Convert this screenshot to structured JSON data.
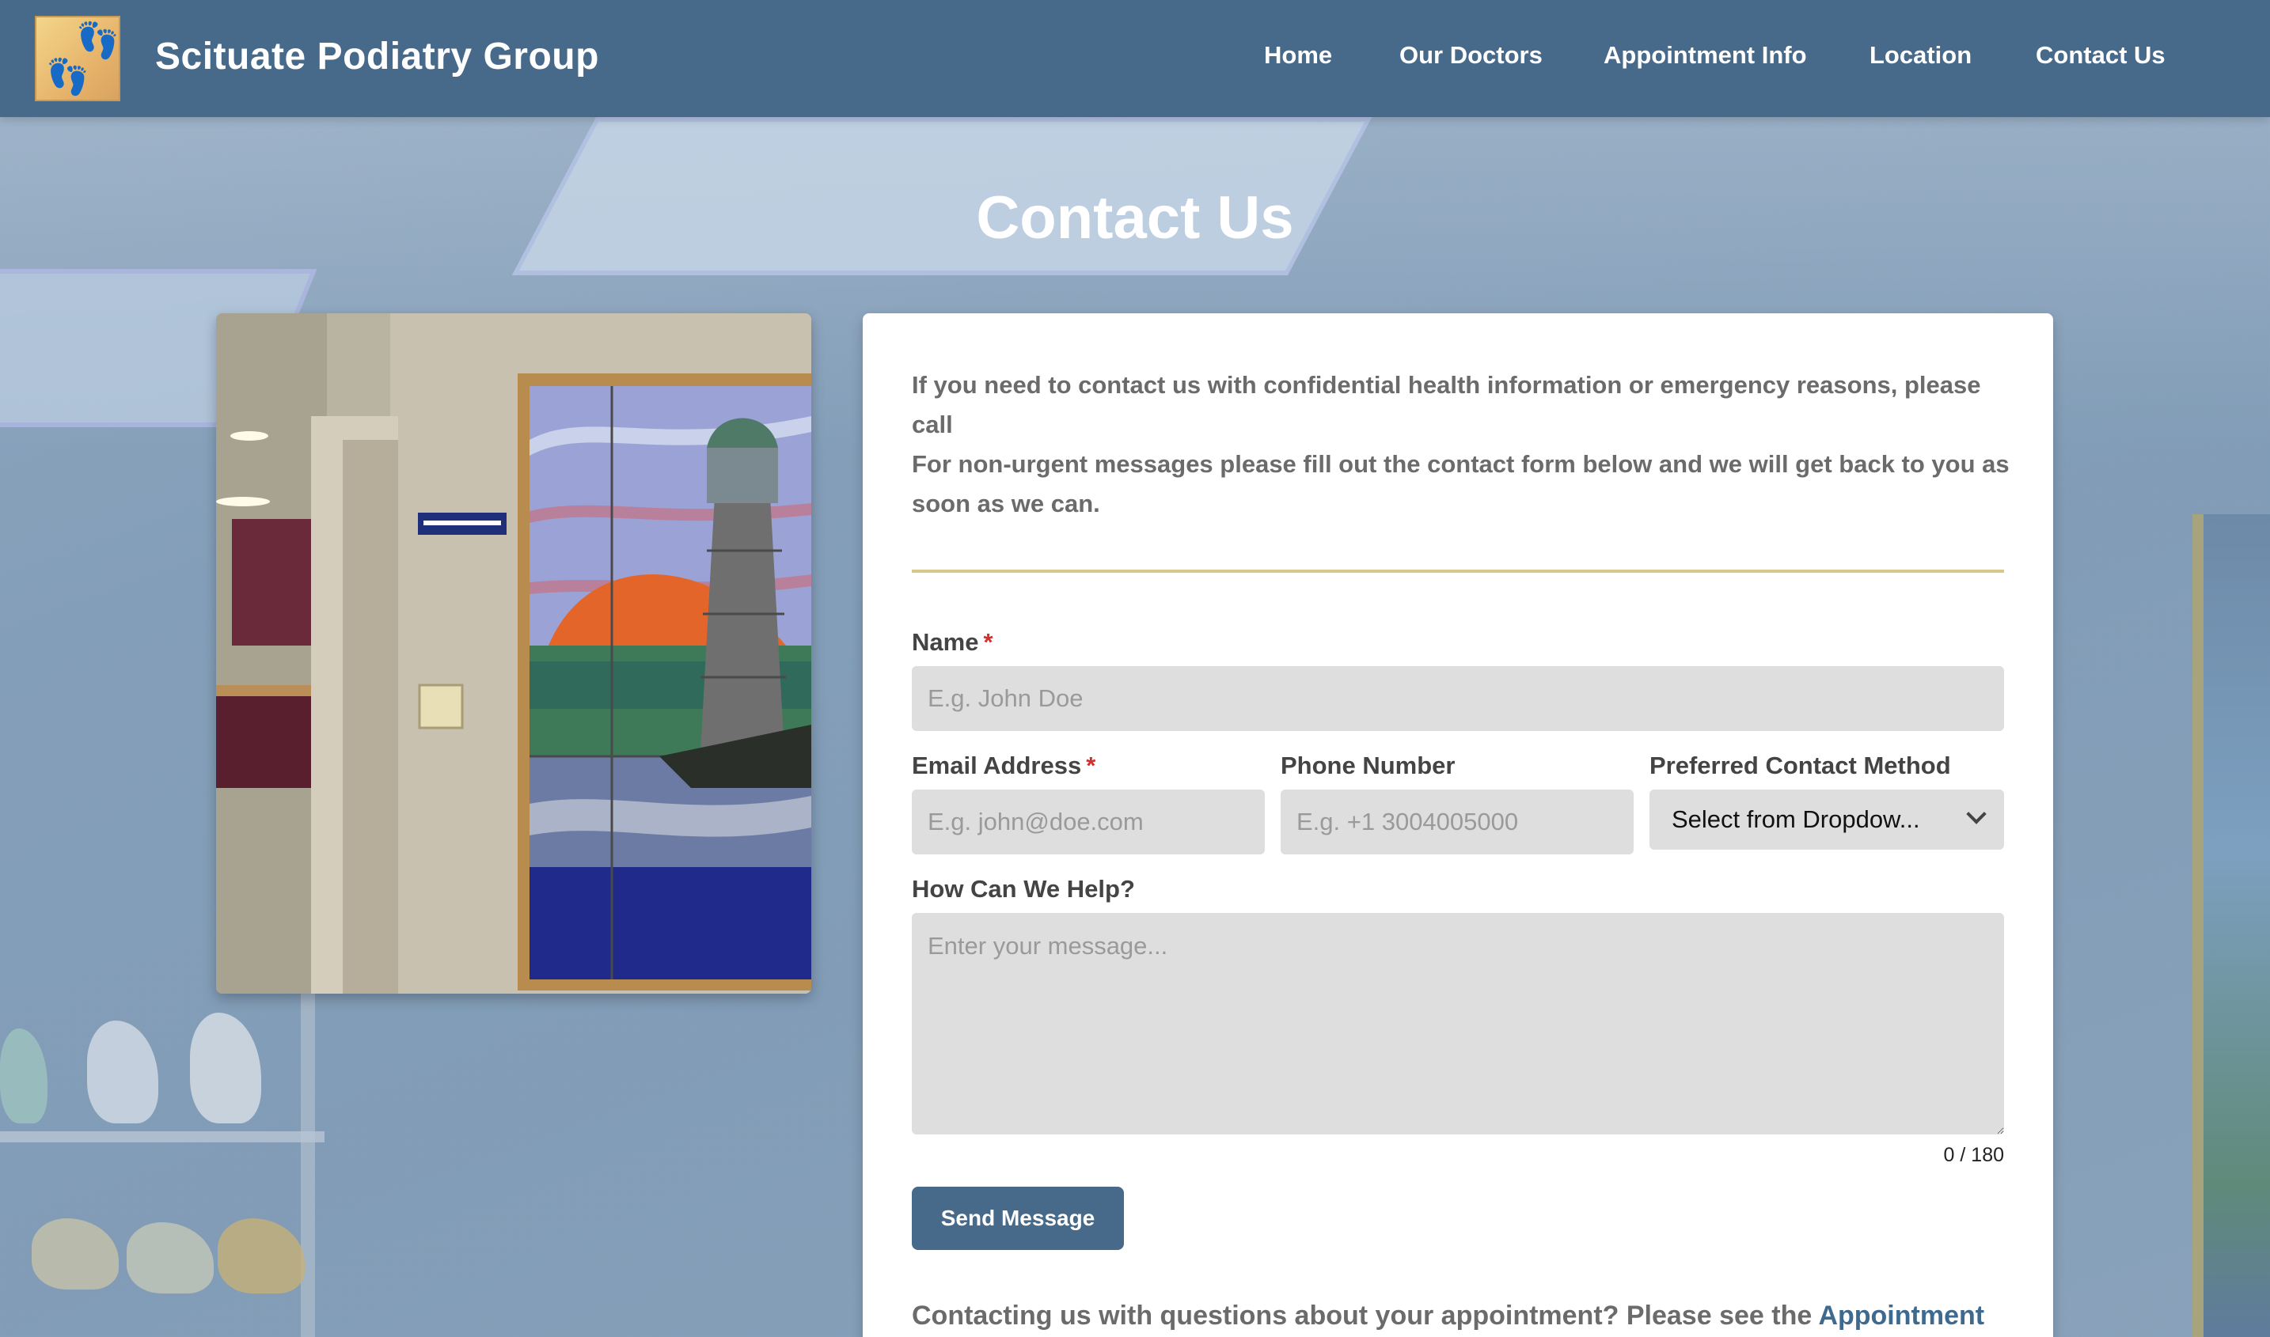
{
  "header": {
    "brand": "Scituate Podiatry Group",
    "nav": [
      "Home",
      "Our Doctors",
      "Appointment Info",
      "Location",
      "Contact Us"
    ]
  },
  "page": {
    "title": "Contact Us"
  },
  "intro": {
    "confidential": "If you need to contact us with confidential health information or emergency reasons, please call",
    "non_urgent": "For non-urgent messages please fill out the contact form below and we will get back to you as soon as we can."
  },
  "form": {
    "name": {
      "label": "Name",
      "required": "*",
      "placeholder": "E.g. John Doe"
    },
    "email": {
      "label": "Email Address",
      "required": "*",
      "placeholder": "E.g. john@doe.com"
    },
    "phone": {
      "label": "Phone Number",
      "placeholder": "E.g. +1 3004005000"
    },
    "contact_method": {
      "label": "Preferred Contact Method",
      "selected": "Select from Dropdow..."
    },
    "message": {
      "label": "How Can We Help?",
      "placeholder": "Enter your message...",
      "counter": "0 / 180"
    },
    "send_label": "Send Message"
  },
  "footer_note": {
    "text": "Contacting us with questions about your appointment? Please see the",
    "link": "Appointment"
  },
  "colors": {
    "header_bg": "#47698a",
    "button_bg": "#47698a",
    "divider": "#d8c78a",
    "required": "#d32f2f",
    "link": "#3f6a90"
  }
}
